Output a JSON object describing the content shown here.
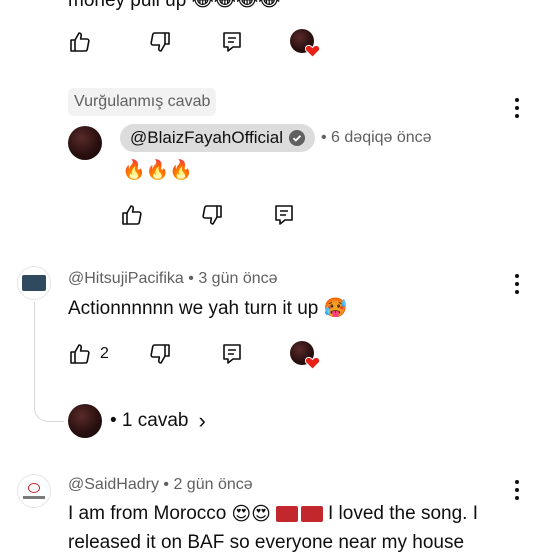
{
  "top_comment": {
    "text_partial": "money pull up",
    "emoji": "😂😂😂😂"
  },
  "highlighted": {
    "label": "Vurğulanmış cavab",
    "author": "@BlaizFayahOfficial",
    "time": "• 6 dəqiqə öncə",
    "text": "🔥🔥🔥"
  },
  "comment1": {
    "author": "@HitsujiPacifika",
    "time": "• 3 gün öncə",
    "text": "Actionnnnnn we yah turn it up",
    "emoji": "🥵",
    "like_count": "2",
    "replies_label": "• 1 cavab",
    "chevron": "›"
  },
  "comment2": {
    "author": "@SaidHadry",
    "time": "• 2 gün öncə",
    "line1_start": "I am from Morocco",
    "line1_emoji": "😍😍",
    "line1_end": "I loved the song. I",
    "line2": "released it on BAF so everyone near my house"
  },
  "icons": {
    "like": "thumb-up-icon",
    "dislike": "thumb-down-icon",
    "reply": "reply-icon",
    "more": "more-vert-icon",
    "verified": "verified-check-icon",
    "heart": "creator-heart-icon"
  },
  "colors": {
    "heart": "#e62117",
    "flag_morocco": "#c1272d"
  }
}
